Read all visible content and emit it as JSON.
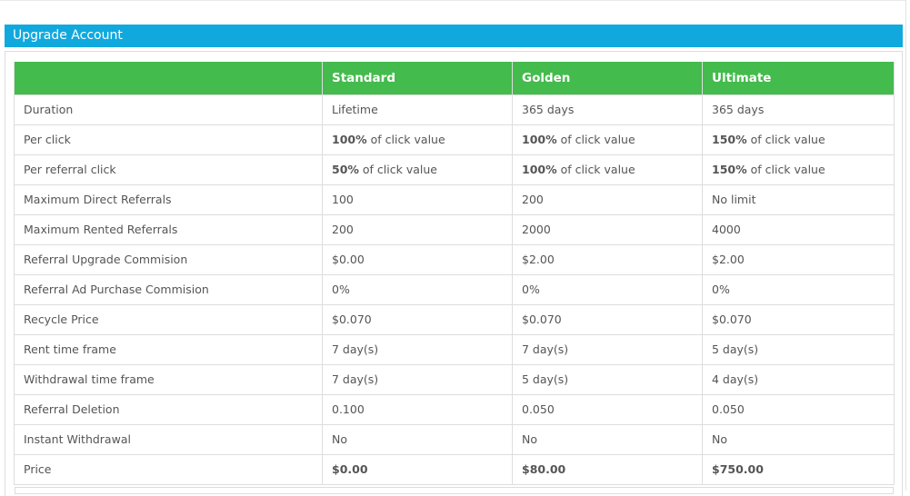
{
  "panel": {
    "title": "Upgrade Account"
  },
  "table": {
    "headers": [
      "",
      "Standard",
      "Golden",
      "Ultimate"
    ],
    "rows": [
      {
        "label": "Duration",
        "values": [
          [
            "",
            "Lifetime"
          ],
          [
            "",
            "365 days"
          ],
          [
            "",
            "365 days"
          ]
        ]
      },
      {
        "label": "Per click",
        "values": [
          [
            "100%",
            " of click value"
          ],
          [
            "100%",
            " of click value"
          ],
          [
            "150%",
            " of click value"
          ]
        ]
      },
      {
        "label": "Per referral click",
        "values": [
          [
            "50%",
            " of click value"
          ],
          [
            "100%",
            " of click value"
          ],
          [
            "150%",
            " of click value"
          ]
        ]
      },
      {
        "label": "Maximum Direct Referrals",
        "values": [
          [
            "",
            "100"
          ],
          [
            "",
            "200"
          ],
          [
            "",
            "No limit"
          ]
        ]
      },
      {
        "label": "Maximum Rented Referrals",
        "values": [
          [
            "",
            "200"
          ],
          [
            "",
            "2000"
          ],
          [
            "",
            "4000"
          ]
        ]
      },
      {
        "label": "Referral Upgrade Commision",
        "values": [
          [
            "",
            "$0.00"
          ],
          [
            "",
            "$2.00"
          ],
          [
            "",
            "$2.00"
          ]
        ]
      },
      {
        "label": "Referral Ad Purchase Commision",
        "values": [
          [
            "",
            "0%"
          ],
          [
            "",
            "0%"
          ],
          [
            "",
            "0%"
          ]
        ]
      },
      {
        "label": "Recycle Price",
        "values": [
          [
            "",
            "$0.070"
          ],
          [
            "",
            "$0.070"
          ],
          [
            "",
            "$0.070"
          ]
        ]
      },
      {
        "label": "Rent time frame",
        "values": [
          [
            "",
            "7 day(s)"
          ],
          [
            "",
            "7 day(s)"
          ],
          [
            "",
            "5 day(s)"
          ]
        ]
      },
      {
        "label": "Withdrawal time frame",
        "values": [
          [
            "",
            "7 day(s)"
          ],
          [
            "",
            "5 day(s)"
          ],
          [
            "",
            "4 day(s)"
          ]
        ]
      },
      {
        "label": "Referral Deletion",
        "values": [
          [
            "",
            "0.100"
          ],
          [
            "",
            "0.050"
          ],
          [
            "",
            "0.050"
          ]
        ]
      },
      {
        "label": "Instant Withdrawal",
        "values": [
          [
            "",
            "No"
          ],
          [
            "",
            "No"
          ],
          [
            "",
            "No"
          ]
        ]
      }
    ],
    "price_row": {
      "label": "Price",
      "values": [
        "$0.00",
        "$80.00",
        "$750.00"
      ]
    }
  },
  "colors": {
    "title_bar": "#11a9dd",
    "header_row": "#44bb4d",
    "text": "#555555",
    "border": "#dddddd"
  }
}
